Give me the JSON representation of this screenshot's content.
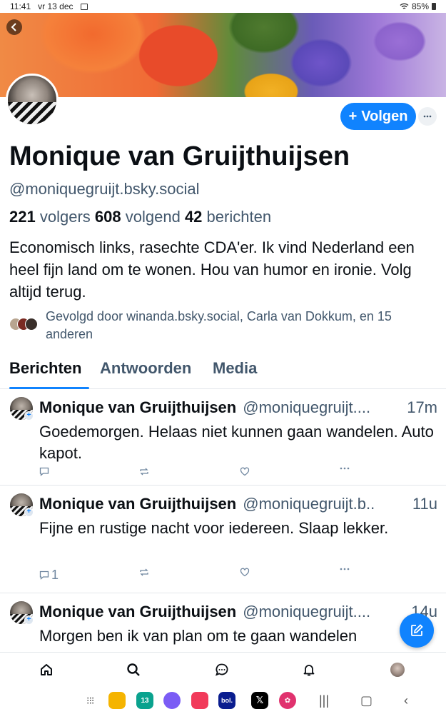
{
  "status": {
    "time": "11:41",
    "date": "vr 13 dec",
    "battery": "85%"
  },
  "profile": {
    "name": "Monique van Gruijthuijsen",
    "handle": "@moniquegruijt.bsky.social",
    "followers_count": "221",
    "followers_label": "volgers",
    "following_count": "608",
    "following_label": "volgend",
    "posts_count": "42",
    "posts_label": "berichten",
    "bio": "Economisch links, rasechte CDA'er. Ik vind Nederland een heel fijn land om te wonen. Hou van humor en ironie. Volg altijd terug.",
    "followed_by": "Gevolgd door winanda.bsky.social, Carla van Dokkum, en 15 anderen",
    "follow_label": "Volgen",
    "follow_plus": "+"
  },
  "tabs": [
    {
      "label": "Berichten"
    },
    {
      "label": "Antwoorden"
    },
    {
      "label": "Media"
    }
  ],
  "posts": [
    {
      "name": "Monique van Gruijthuijsen",
      "handle": "@moniquegruijt....",
      "time": "17m",
      "text": "Goedemorgen. Helaas niet kunnen gaan wandelen. Auto kapot.",
      "replies": ""
    },
    {
      "name": "Monique van Gruijthuijsen",
      "handle": "@moniquegruijt.b..",
      "time": "11u",
      "text": "Fijne en rustige nacht voor iedereen. Slaap lekker.",
      "replies": "1"
    },
    {
      "name": "Monique van Gruijthuijsen",
      "handle": "@moniquegruijt....",
      "time": "14u",
      "text": "Morgen ben ik van plan om te gaan wandelen",
      "replies": ""
    }
  ],
  "icons": {
    "back": "chevron-left-icon",
    "compose": "pencil-icon",
    "nav": [
      "home-icon",
      "search-icon",
      "chat-icon",
      "bell-icon",
      "profile-avatar"
    ]
  },
  "colors": {
    "accent": "#1083fe",
    "muted": "#42576c",
    "text": "#0b0f14"
  },
  "dock": {
    "calendar_day": "13",
    "bol_label": "bol."
  }
}
